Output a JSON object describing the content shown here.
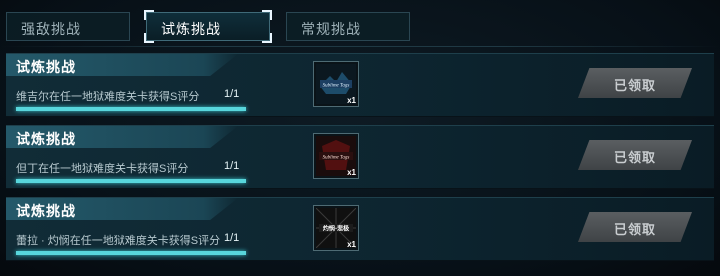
{
  "tabs": [
    {
      "label": "强敌挑战",
      "active": false
    },
    {
      "label": "试炼挑战",
      "active": true
    },
    {
      "label": "常规挑战",
      "active": false
    }
  ],
  "rows": [
    {
      "title": "试炼挑战",
      "description": "维吉尔在任一地狱难度关卡获得S评分",
      "progress_text": "1/1",
      "progress": 1.0,
      "reward": {
        "quantity": "x1",
        "art_text": "Sublime Tags",
        "icon": "title-badge-blue-icon"
      },
      "claim_label": "已领取"
    },
    {
      "title": "试炼挑战",
      "description": "但丁在任一地狱难度关卡获得S评分",
      "progress_text": "1/1",
      "progress": 1.0,
      "reward": {
        "quantity": "x1",
        "art_text": "Sublime Tags",
        "icon": "title-badge-red-icon"
      },
      "claim_label": "已领取"
    },
    {
      "title": "试炼挑战",
      "description": "蕾拉 · 灼悯在任一地狱难度关卡获得S评分",
      "progress_text": "1/1",
      "progress": 1.0,
      "reward": {
        "quantity": "x1",
        "art_text": "灼悯·悲极",
        "icon": "title-badge-white-icon"
      },
      "claim_label": "已领取"
    }
  ],
  "colors": {
    "accent": "#58d6dc",
    "claimed_button": "#4b4f52"
  }
}
